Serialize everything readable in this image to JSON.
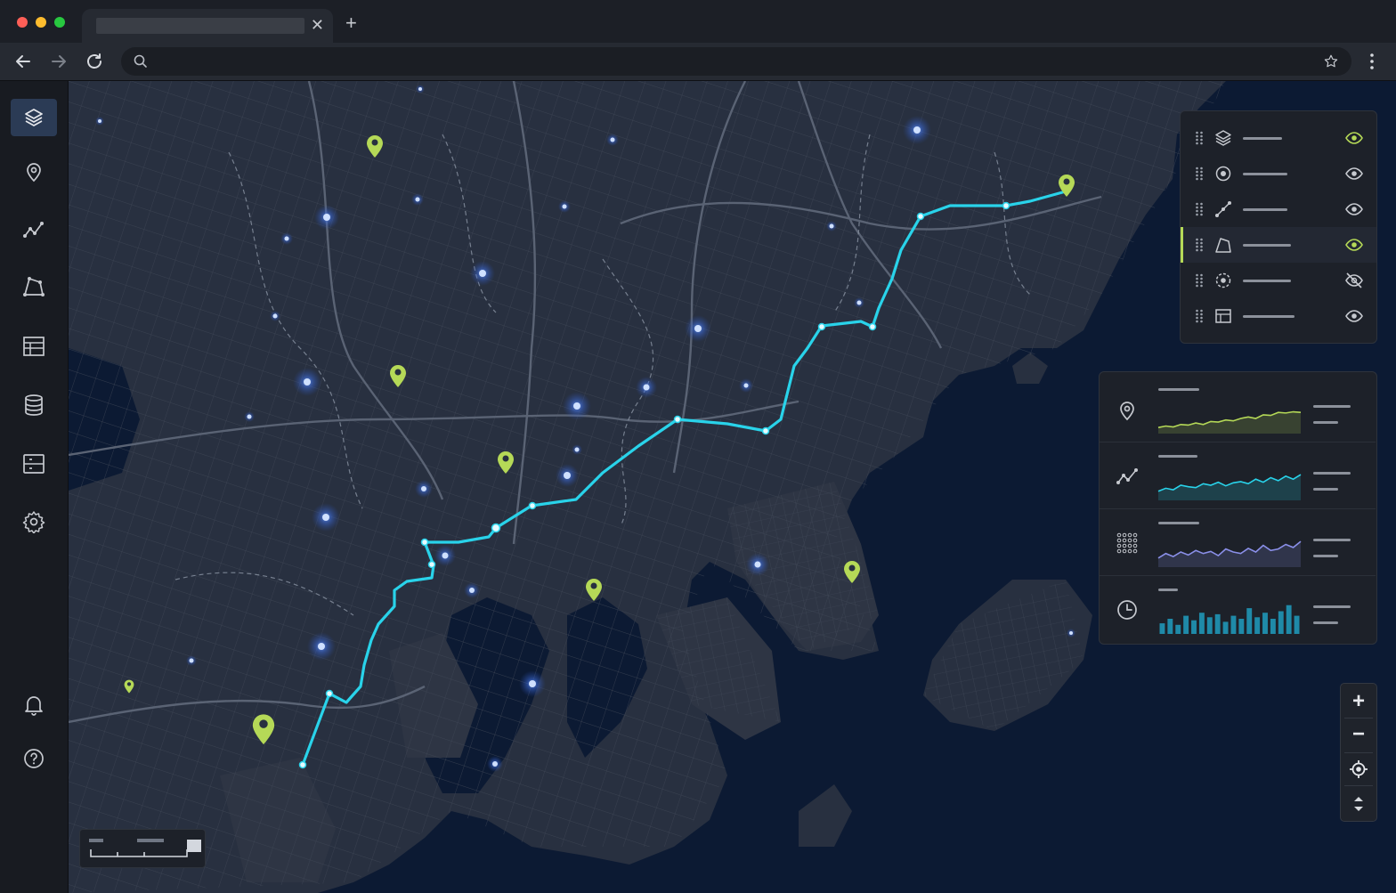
{
  "browser": {
    "tab_title": "",
    "tab_close": "✕",
    "new_tab": "+",
    "address_value": "",
    "address_placeholder": ""
  },
  "colors": {
    "route": "#29d3ea",
    "marker_green": "#b5d957",
    "poi_blue": "#4f86ff",
    "map_water": "#0c1a33",
    "map_land": "#2a303c",
    "sidebar_active": "#2b3b55"
  },
  "sidebar": {
    "items": [
      {
        "icon": "layers-icon",
        "active": true
      },
      {
        "icon": "map-pin-icon",
        "active": false
      },
      {
        "icon": "route-icon",
        "active": false
      },
      {
        "icon": "polygon-icon",
        "active": false
      },
      {
        "icon": "table-icon",
        "active": false
      },
      {
        "icon": "database-icon",
        "active": false
      },
      {
        "icon": "server-icon",
        "active": false
      },
      {
        "icon": "gear-icon",
        "active": false
      }
    ],
    "bottom": [
      {
        "icon": "bell-icon"
      },
      {
        "icon": "help-icon"
      }
    ]
  },
  "layer_panel": {
    "layers": [
      {
        "icon": "layers-icon",
        "name": "",
        "visible": true,
        "eye_color": "#b5d957",
        "selected": false
      },
      {
        "icon": "point-icon",
        "name": "",
        "visible": true,
        "eye_color": "#c6c9cf",
        "selected": false
      },
      {
        "icon": "line-icon",
        "name": "",
        "visible": true,
        "eye_color": "#c6c9cf",
        "selected": false
      },
      {
        "icon": "polygon-icon",
        "name": "",
        "visible": true,
        "eye_color": "#b5d957",
        "selected": true
      },
      {
        "icon": "target-icon",
        "name": "",
        "visible": false,
        "eye_color": "#c6c9cf",
        "selected": false
      },
      {
        "icon": "table-icon",
        "name": "",
        "visible": true,
        "eye_color": "#c6c9cf",
        "selected": false
      }
    ]
  },
  "stats_panel": {
    "rows": [
      {
        "icon": "map-pin-icon",
        "label": "",
        "chart": "line",
        "color": "#b5d957",
        "values": [
          0.2,
          0.25,
          0.22,
          0.3,
          0.28,
          0.35,
          0.3,
          0.4,
          0.38,
          0.45,
          0.42,
          0.5,
          0.55,
          0.5,
          0.62,
          0.6,
          0.7,
          0.68,
          0.72,
          0.7
        ]
      },
      {
        "icon": "route-icon",
        "label": "",
        "chart": "line",
        "color": "#29d3ea",
        "values": [
          0.3,
          0.4,
          0.35,
          0.5,
          0.45,
          0.42,
          0.55,
          0.5,
          0.6,
          0.48,
          0.58,
          0.62,
          0.55,
          0.7,
          0.6,
          0.75,
          0.65,
          0.8,
          0.7,
          0.85
        ]
      },
      {
        "icon": "grid-icon",
        "label": "",
        "chart": "line",
        "color": "#8a8fe8",
        "values": [
          0.3,
          0.45,
          0.35,
          0.5,
          0.4,
          0.55,
          0.45,
          0.52,
          0.38,
          0.6,
          0.5,
          0.45,
          0.62,
          0.5,
          0.72,
          0.55,
          0.6,
          0.75,
          0.65,
          0.85
        ]
      },
      {
        "icon": "clock-icon",
        "label": "",
        "chart": "bar",
        "color": "#1f8aa8",
        "values": [
          0.35,
          0.5,
          0.3,
          0.6,
          0.45,
          0.7,
          0.55,
          0.65,
          0.4,
          0.6,
          0.5,
          0.85,
          0.55,
          0.7,
          0.5,
          0.75,
          0.95,
          0.6
        ]
      }
    ]
  },
  "zoom_controls": {
    "zoom_in": "+",
    "zoom_out": "−"
  },
  "scale_bar": {
    "label": ""
  }
}
